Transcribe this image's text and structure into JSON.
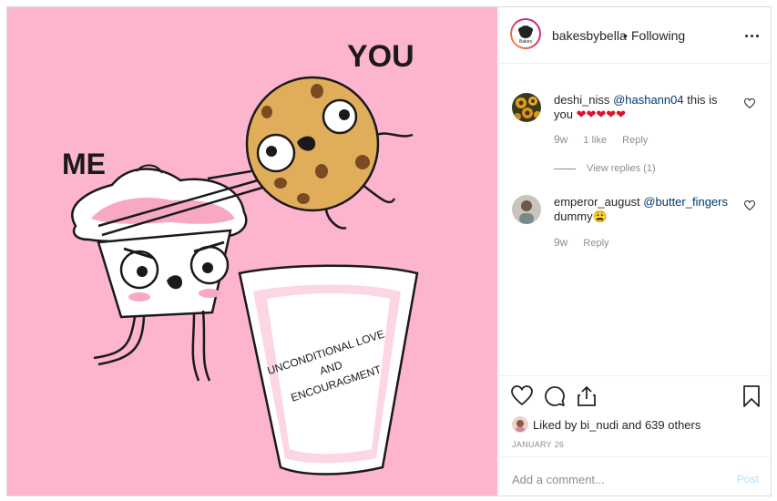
{
  "header": {
    "username": "bakesbybella",
    "separator": "•",
    "follow_status": "Following",
    "avatar_text": "Bakes"
  },
  "image": {
    "label_me": "ME",
    "label_you": "YOU",
    "glass_text_line1": "UNCONDITIONAL LOVE",
    "glass_text_line2": "AND",
    "glass_text_line3": "ENCOURAGMENT"
  },
  "comments": [
    {
      "user": "deshi_niss",
      "mention": "@hashann04",
      "text_line1": "this is",
      "text_line2": "you",
      "emoji": "❤❤❤❤❤",
      "time": "9w",
      "likes": "1 like",
      "reply": "Reply",
      "view_replies": "View replies (1)"
    },
    {
      "user": "emperor_august",
      "mention": "@butter_fingers",
      "text": "dummy",
      "emoji": "😩",
      "time": "9w",
      "reply": "Reply"
    }
  ],
  "actions": {
    "liked_by_prefix": "Liked by",
    "liked_by_user": "bi_nudi",
    "liked_by_suffix": "and",
    "others": "639 others",
    "date": "JANUARY 26"
  },
  "add_comment": {
    "placeholder": "Add a comment...",
    "post_label": "Post"
  },
  "colors": {
    "image_bg": "#fcb4cf",
    "mention": "#00376b",
    "post_disabled": "#b2dffc",
    "heart_red": "#ed4956"
  }
}
